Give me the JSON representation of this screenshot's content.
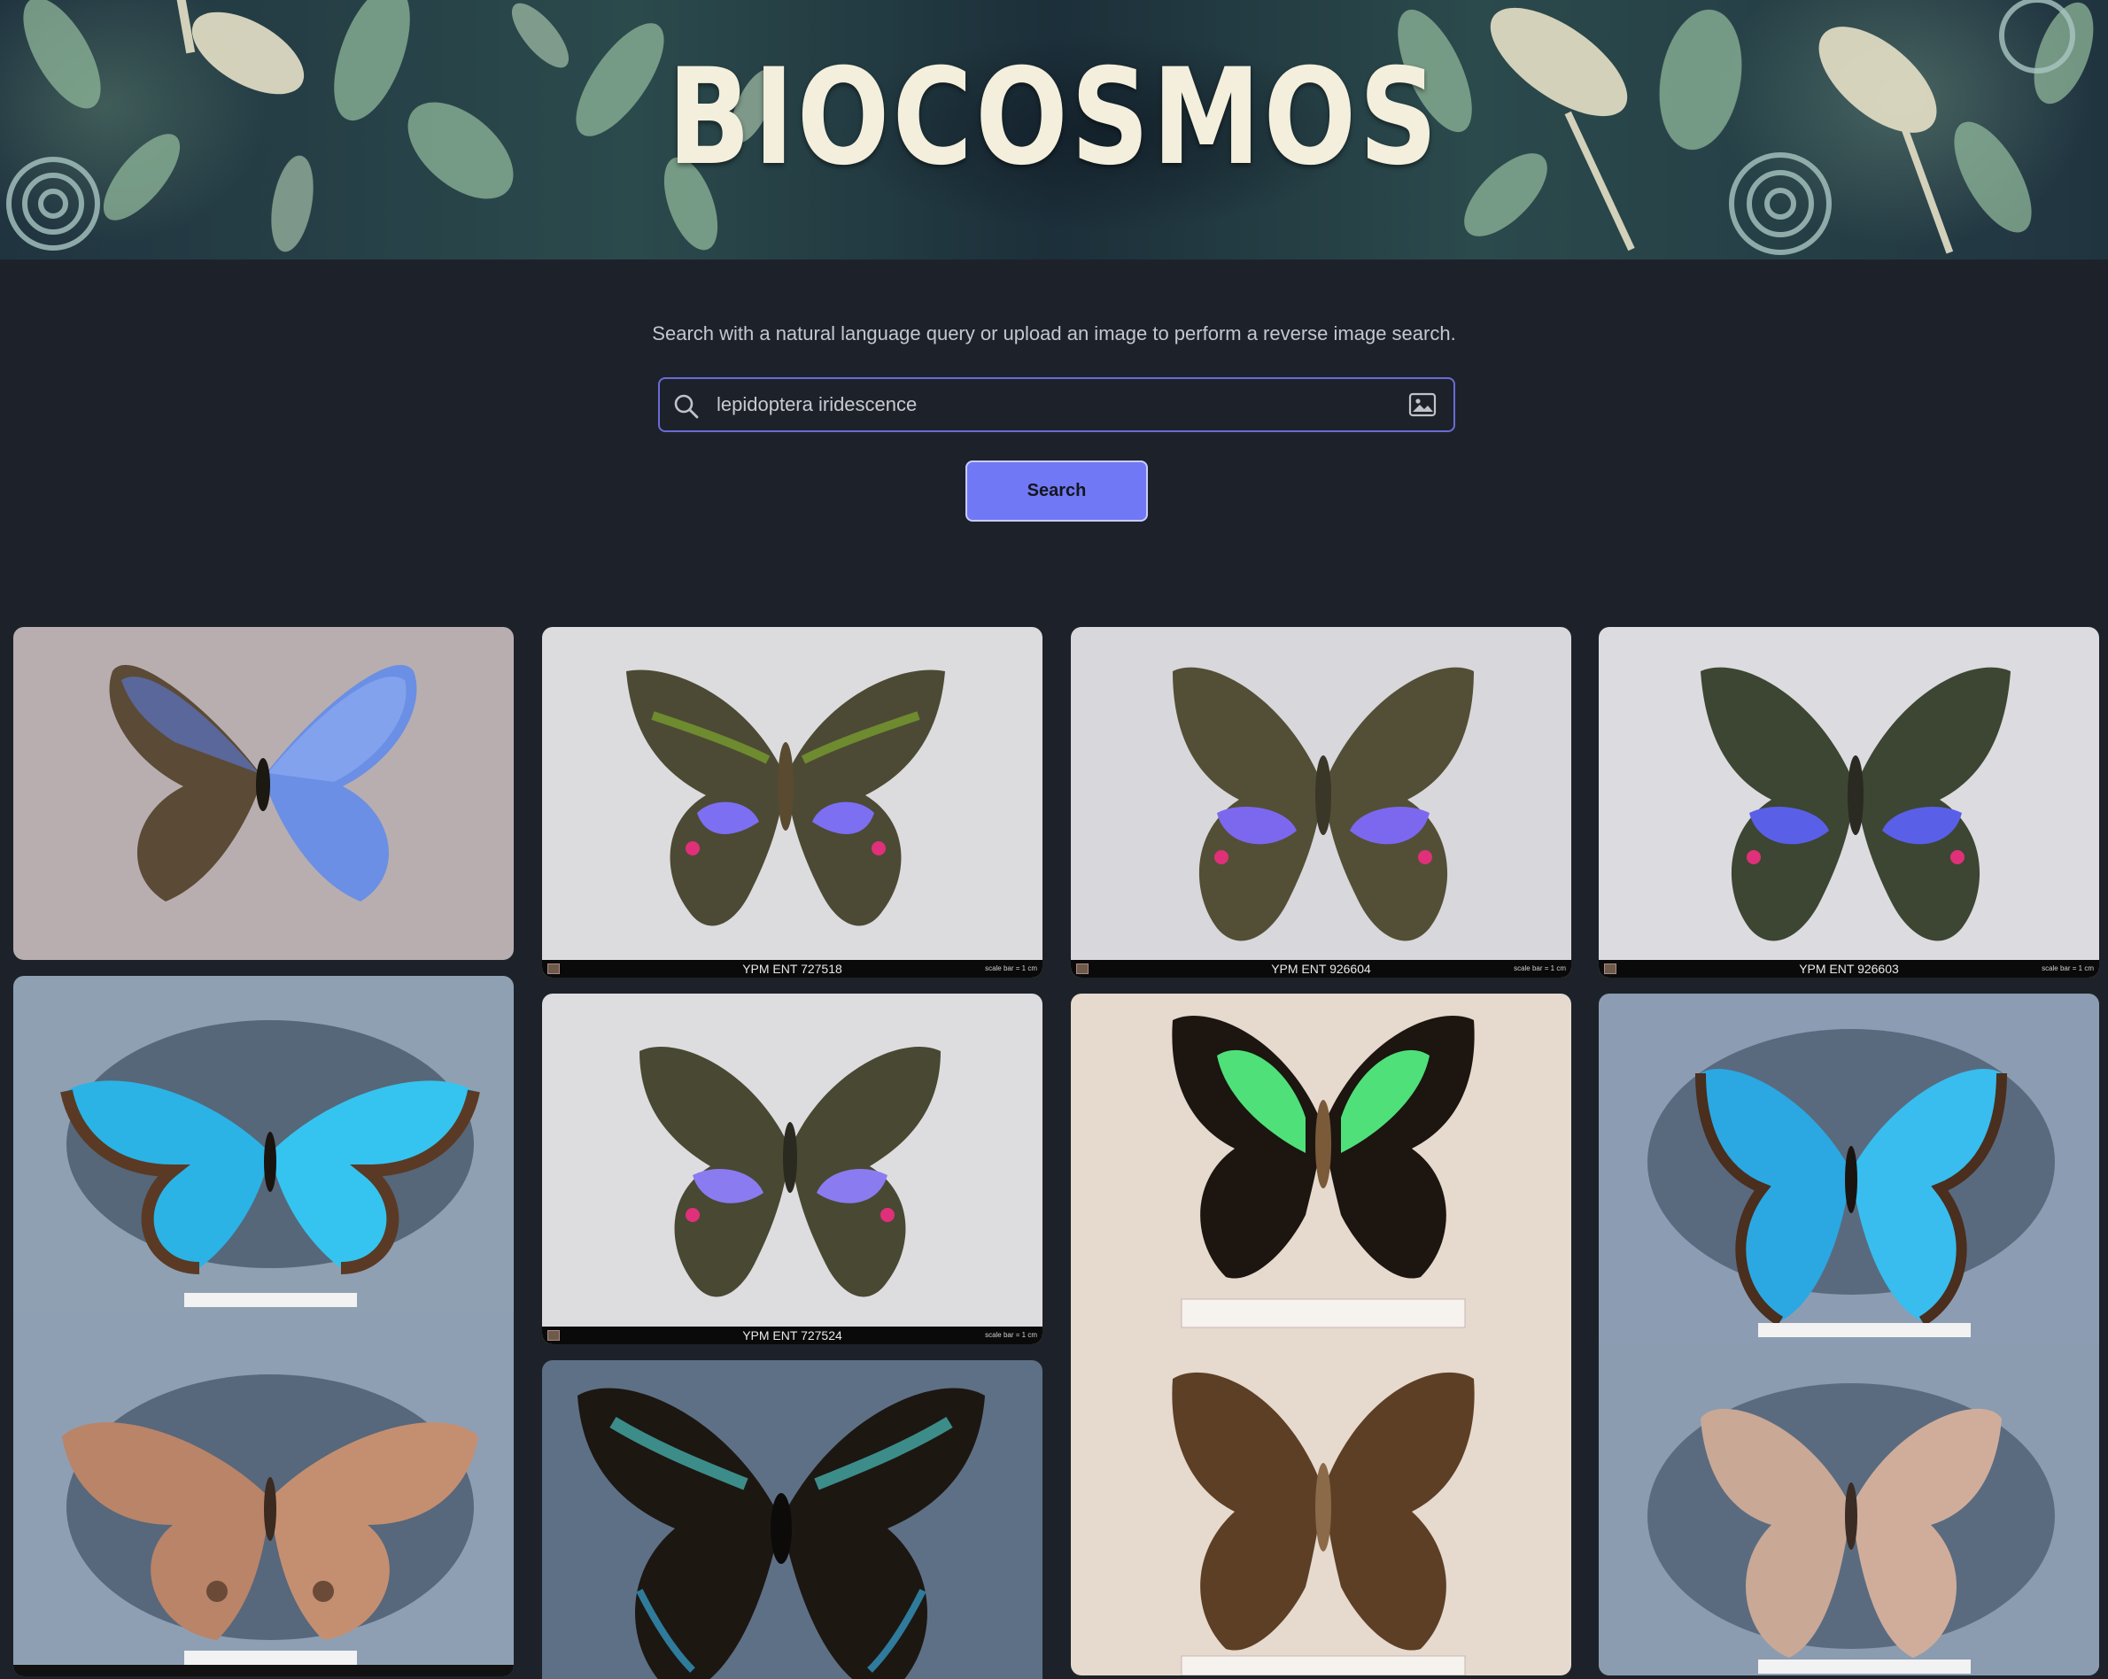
{
  "banner": {
    "title": "BIOCOSMOS"
  },
  "search": {
    "tagline": "Search with a natural language query or upload an image to perform a reverse image search.",
    "query": "lepidoptera iridescence",
    "button_label": "Search",
    "search_icon": "search-icon",
    "image_upload_icon": "image-icon"
  },
  "results": {
    "captions": {
      "c2": "YPM ENT 727518",
      "c3": "YPM ENT 926604",
      "c4": "YPM ENT 926603",
      "c6": "YPM ENT 727524",
      "scale_note": "scale bar = 1 cm"
    }
  },
  "colors": {
    "page_bg": "#1d222a",
    "accent": "#7078f5",
    "input_border": "#6b6bd6"
  }
}
